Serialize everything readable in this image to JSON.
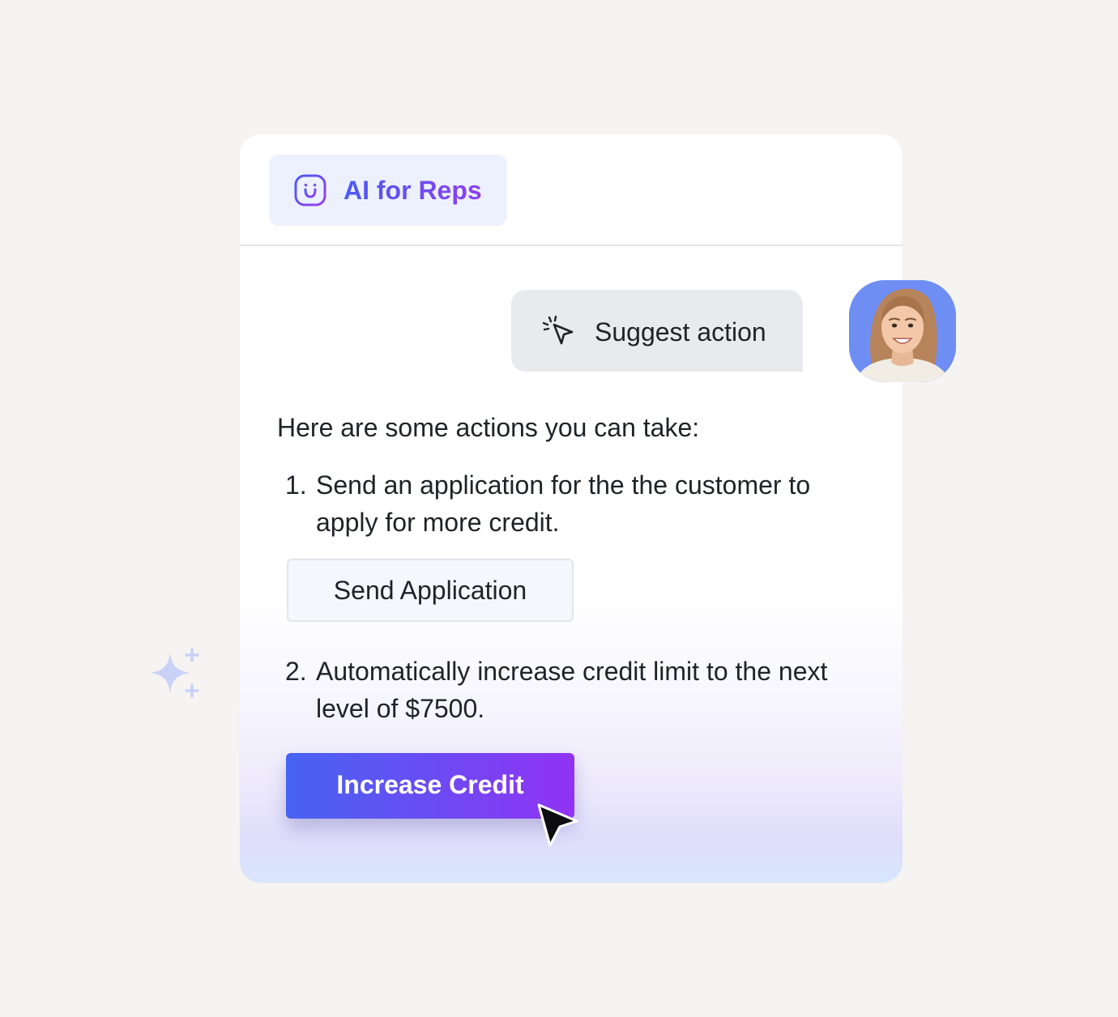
{
  "header": {
    "tab_label": "AI for Reps",
    "tab_icon": "smile-box-icon"
  },
  "user_message": {
    "label": "Suggest action",
    "icon": "pointer-click-icon",
    "avatar": "user-avatar"
  },
  "response": {
    "intro": "Here are some actions you can take:",
    "steps": [
      {
        "number": "1.",
        "text": "Send an application for the the customer to apply for more credit.",
        "button_label": "Send Application"
      },
      {
        "number": "2.",
        "text": "Automatically increase credit limit to the next level of $7500.",
        "button_label": "Increase Credit"
      }
    ]
  },
  "colors": {
    "accent_start": "#4663f2",
    "accent_end": "#9232f3",
    "page_background": "#f5f4f2"
  }
}
